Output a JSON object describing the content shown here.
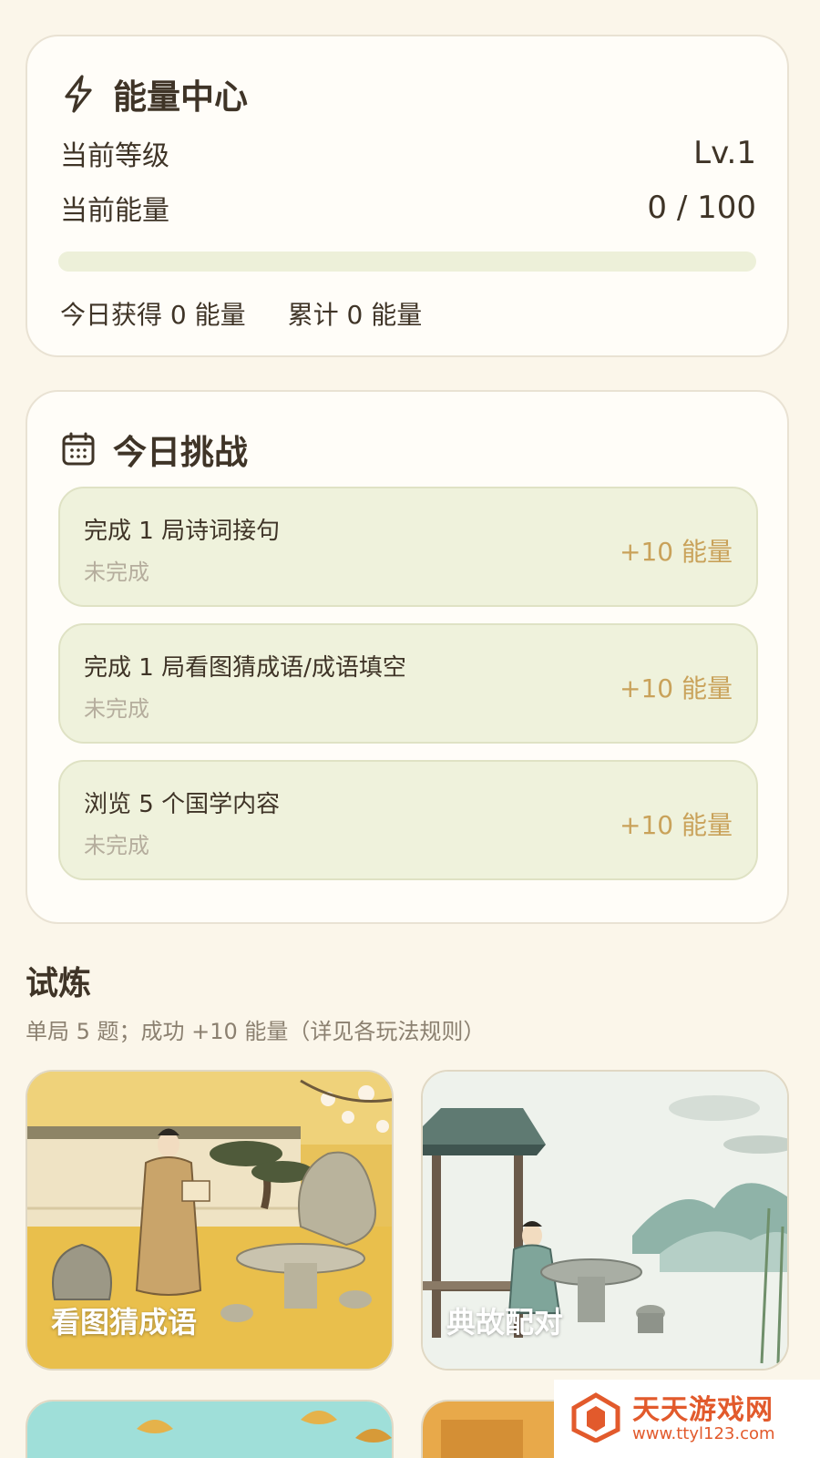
{
  "energy_center": {
    "title": "能量中心",
    "icon": "lightning-icon",
    "level_label": "当前等级",
    "level_value": "Lv.1",
    "energy_label": "当前能量",
    "energy_value": "0 / 100",
    "progress_fraction": 0,
    "today_earned": "今日获得 0 能量",
    "total_earned": "累计 0 能量"
  },
  "challenge": {
    "title": "今日挑战",
    "icon": "calendar-icon",
    "tasks": [
      {
        "title": "完成 1 局诗词接句",
        "status": "未完成",
        "reward": "+10 能量"
      },
      {
        "title": "完成 1 局看图猜成语/成语填空",
        "status": "未完成",
        "reward": "+10 能量"
      },
      {
        "title": "浏览 5 个国学内容",
        "status": "未完成",
        "reward": "+10 能量"
      }
    ]
  },
  "trials": {
    "title": "试炼",
    "subtitle": "单局 5 题；成功 +10 能量（详见各玩法规则）",
    "games": [
      {
        "label": "看图猜成语"
      },
      {
        "label": "典故配对"
      }
    ]
  },
  "watermark": {
    "title": "天天游戏网",
    "url": "www.ttyl123.com"
  },
  "colors": {
    "background": "#fbf6ea",
    "card": "#fffdf8",
    "task_bg": "#eff2dc",
    "reward": "#c9a25a",
    "text": "#3f3427",
    "muted": "#b5ad9d",
    "watermark": "#e25a2c"
  }
}
